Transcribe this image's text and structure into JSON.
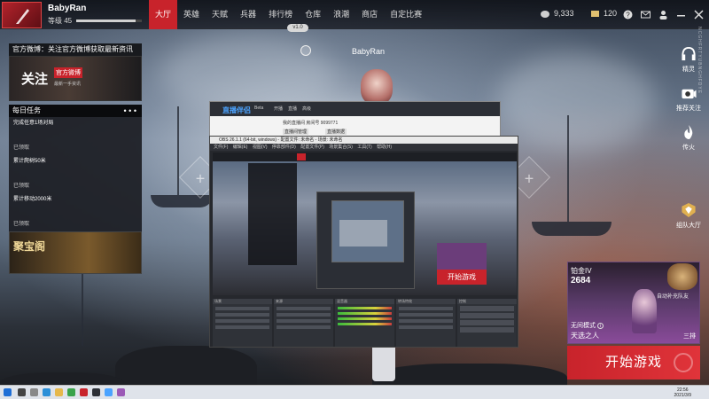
{
  "header": {
    "username": "BabyRan",
    "level": "等级 45",
    "xp_fraction": 0.9,
    "nav": [
      "大厅",
      "英雄",
      "天赋",
      "兵器",
      "排行榜",
      "仓库",
      "浪潮",
      "商店",
      "自定比赛"
    ],
    "active_nav": "大厅",
    "coins": "9,333",
    "gold": "120",
    "version_pill": "v1.0",
    "icons": [
      "help-icon",
      "mail-icon",
      "friends-icon",
      "minimize-icon",
      "close-icon"
    ]
  },
  "left": {
    "weibo_title": "官方微博：关注官方微博获取最新资讯",
    "weibo_big": "关注",
    "weibo_small": "官方微博",
    "weibo_tiny": "最新一手资讯",
    "tasks_title": "每日任务",
    "tasks": [
      {
        "text": "完成任意1场对局",
        "status": "已领取"
      },
      {
        "text": "累计爬树50米",
        "status": "已领取"
      },
      {
        "text": "累计移动2000米",
        "status": "已领取"
      }
    ],
    "treasure": "聚宝阁"
  },
  "center": {
    "player_name": "BabyRan"
  },
  "streaming": {
    "app_logo": "直播伴侣",
    "app_badge": "Beta",
    "tabs": [
      "开播",
      "直播",
      "高级"
    ],
    "room_line": "我的直播间 房间号 9099771",
    "btn_manage": "直播间管理",
    "btn_data": "直播数据",
    "obs_title": "OBS 26.1.1 (64-bit, windows) - 配置文件: 未命名 - 场景: 未命名",
    "obs_menu": "文件(F) 编辑(E) 视图(V) 停靠部件(D) 配置文件(P) 场景集合(S) 工具(T) 帮助(H)",
    "docks": [
      "场景",
      "来源",
      "混音器",
      "转场特效",
      "控制"
    ],
    "mini_start": "开始游戏"
  },
  "right": {
    "buttons": [
      {
        "label": "精灵",
        "icon": "headset-icon"
      },
      {
        "label": "推荐关注",
        "icon": "camera-icon"
      },
      {
        "label": "传火",
        "icon": "flame-icon"
      },
      {
        "label": "组队大厅",
        "icon": "team-badge-icon"
      }
    ],
    "vertical_text": "NCGHFRTYUBNGHFDYE",
    "rank_tier": "铂金IV",
    "rank_score": "2684",
    "auto_team": "自动补充队友",
    "mode": "无间模式",
    "map": "天选之人",
    "team_size": "三排",
    "start_button": "开始游戏"
  },
  "taskbar": {
    "time": "22:56",
    "date": "2021/3/9"
  }
}
